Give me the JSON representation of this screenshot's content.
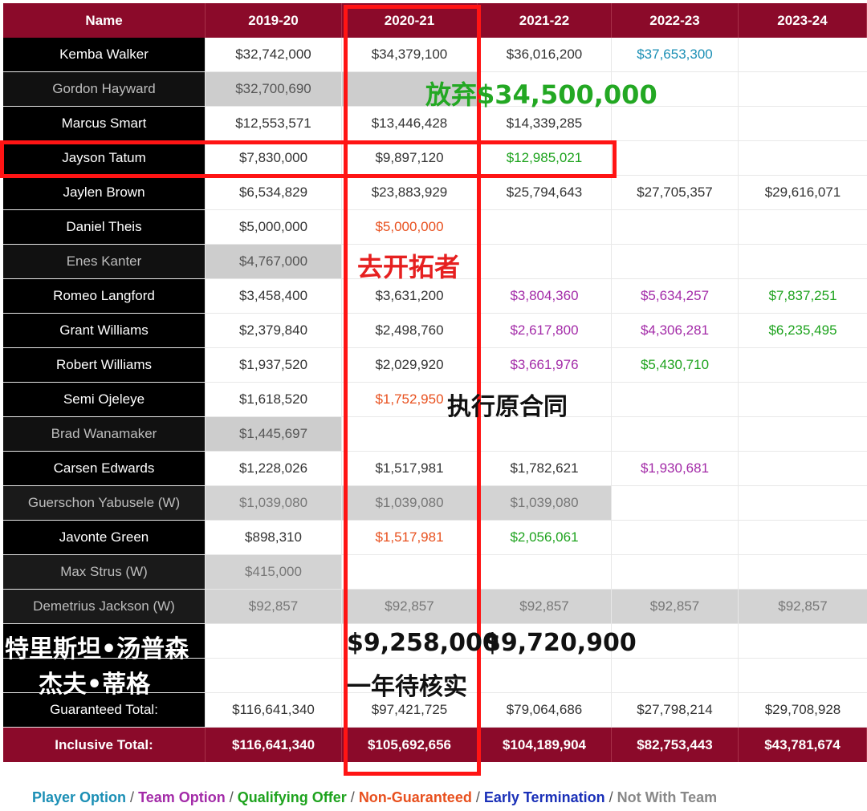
{
  "headers": [
    "Name",
    "2019-20",
    "2020-21",
    "2021-22",
    "2022-23",
    "2023-24"
  ],
  "rows": [
    {
      "name": "Kemba Walker",
      "cells": [
        "$32,742,000",
        "$34,379,100",
        "$36,016,200",
        "$37,653,300",
        ""
      ],
      "classes": [
        "",
        "",
        "",
        "c-player",
        ""
      ],
      "name_class": ""
    },
    {
      "name": "Gordon Hayward",
      "cells": [
        "$32,700,690",
        "",
        "",
        "",
        ""
      ],
      "classes": [
        "gray",
        "gray",
        "",
        "",
        ""
      ],
      "name_class": "gone"
    },
    {
      "name": "Marcus Smart",
      "cells": [
        "$12,553,571",
        "$13,446,428",
        "$14,339,285",
        "",
        ""
      ],
      "classes": [
        "",
        "",
        "",
        "",
        ""
      ],
      "name_class": ""
    },
    {
      "name": "Jayson Tatum",
      "cells": [
        "$7,830,000",
        "$9,897,120",
        "$12,985,021",
        "",
        ""
      ],
      "classes": [
        "",
        "",
        "c-qual",
        "",
        ""
      ],
      "name_class": ""
    },
    {
      "name": "Jaylen Brown",
      "cells": [
        "$6,534,829",
        "$23,883,929",
        "$25,794,643",
        "$27,705,357",
        "$29,616,071"
      ],
      "classes": [
        "",
        "",
        "",
        "",
        ""
      ],
      "name_class": ""
    },
    {
      "name": "Daniel Theis",
      "cells": [
        "$5,000,000",
        "$5,000,000",
        "",
        "",
        ""
      ],
      "classes": [
        "",
        "c-nonguar",
        "",
        "",
        ""
      ],
      "name_class": ""
    },
    {
      "name": "Enes Kanter",
      "cells": [
        "$4,767,000",
        "",
        "",
        "",
        ""
      ],
      "classes": [
        "gray",
        "",
        "",
        "",
        ""
      ],
      "name_class": "gone"
    },
    {
      "name": "Romeo Langford",
      "cells": [
        "$3,458,400",
        "$3,631,200",
        "$3,804,360",
        "$5,634,257",
        "$7,837,251"
      ],
      "classes": [
        "",
        "",
        "c-team",
        "c-team",
        "c-qual"
      ],
      "name_class": ""
    },
    {
      "name": "Grant Williams",
      "cells": [
        "$2,379,840",
        "$2,498,760",
        "$2,617,800",
        "$4,306,281",
        "$6,235,495"
      ],
      "classes": [
        "",
        "",
        "c-team",
        "c-team",
        "c-qual"
      ],
      "name_class": ""
    },
    {
      "name": "Robert Williams",
      "cells": [
        "$1,937,520",
        "$2,029,920",
        "$3,661,976",
        "$5,430,710",
        ""
      ],
      "classes": [
        "",
        "",
        "c-team",
        "c-qual",
        ""
      ],
      "name_class": ""
    },
    {
      "name": "Semi Ojeleye",
      "cells": [
        "$1,618,520",
        "$1,752,950",
        "",
        "",
        ""
      ],
      "classes": [
        "",
        "c-nonguar",
        "",
        "",
        ""
      ],
      "name_class": ""
    },
    {
      "name": "Brad Wanamaker",
      "cells": [
        "$1,445,697",
        "",
        "",
        "",
        ""
      ],
      "classes": [
        "gray",
        "",
        "",
        "",
        ""
      ],
      "name_class": "gone"
    },
    {
      "name": "Carsen Edwards",
      "cells": [
        "$1,228,026",
        "$1,517,981",
        "$1,782,621",
        "$1,930,681",
        ""
      ],
      "classes": [
        "",
        "",
        "",
        "c-team",
        ""
      ],
      "name_class": ""
    },
    {
      "name": "Guerschon Yabusele (W)",
      "cells": [
        "$1,039,080",
        "$1,039,080",
        "$1,039,080",
        "",
        ""
      ],
      "classes": [
        "gray-light",
        "gray-light",
        "gray-light",
        "",
        ""
      ],
      "name_class": "gone"
    },
    {
      "name": "Javonte Green",
      "cells": [
        "$898,310",
        "$1,517,981",
        "$2,056,061",
        "",
        ""
      ],
      "classes": [
        "",
        "c-nonguar",
        "c-qual",
        "",
        ""
      ],
      "name_class": ""
    },
    {
      "name": "Max Strus (W)",
      "cells": [
        "$415,000",
        "",
        "",
        "",
        ""
      ],
      "classes": [
        "gray-light",
        "",
        "",
        "",
        ""
      ],
      "name_class": "gone"
    },
    {
      "name": "Demetrius Jackson (W)",
      "cells": [
        "$92,857",
        "$92,857",
        "$92,857",
        "$92,857",
        "$92,857"
      ],
      "classes": [
        "gray-light",
        "gray-light",
        "gray-light",
        "gray-light",
        "gray-light"
      ],
      "name_class": "gone"
    },
    {
      "name": "",
      "cells": [
        "",
        "",
        "",
        "",
        ""
      ],
      "classes": [
        "",
        "",
        "",
        "",
        ""
      ],
      "name_class": ""
    },
    {
      "name": "",
      "cells": [
        "",
        "",
        "",
        "",
        ""
      ],
      "classes": [
        "",
        "",
        "",
        "",
        ""
      ],
      "name_class": ""
    },
    {
      "name": "Guaranteed Total:",
      "cells": [
        "$116,641,340",
        "$97,421,725",
        "$79,064,686",
        "$27,798,214",
        "$29,708,928"
      ],
      "classes": [
        "",
        "",
        "",
        "",
        ""
      ],
      "name_class": ""
    }
  ],
  "inclusive": {
    "label": "Inclusive Total:",
    "cells": [
      "$116,641,340",
      "$105,692,656",
      "$104,189,904",
      "$82,753,443",
      "$43,781,674"
    ]
  },
  "annotations": {
    "hayward": "放弃$34,500,000",
    "kanter": "去开拓者",
    "ojeleye": "执行原合同",
    "thompson_name": "特里斯坦•汤普森",
    "teague_name": "杰夫•蒂格",
    "thompson_y1": "$9,258,000",
    "thompson_y2": "$9,720,900",
    "teague_note": "一年待核实"
  },
  "legend": {
    "player": "Player Option",
    "team": "Team Option",
    "qual": "Qualifying Offer",
    "nonguar": "Non-Guaranteed",
    "early": "Early Termination",
    "gone": "Not With Team"
  }
}
